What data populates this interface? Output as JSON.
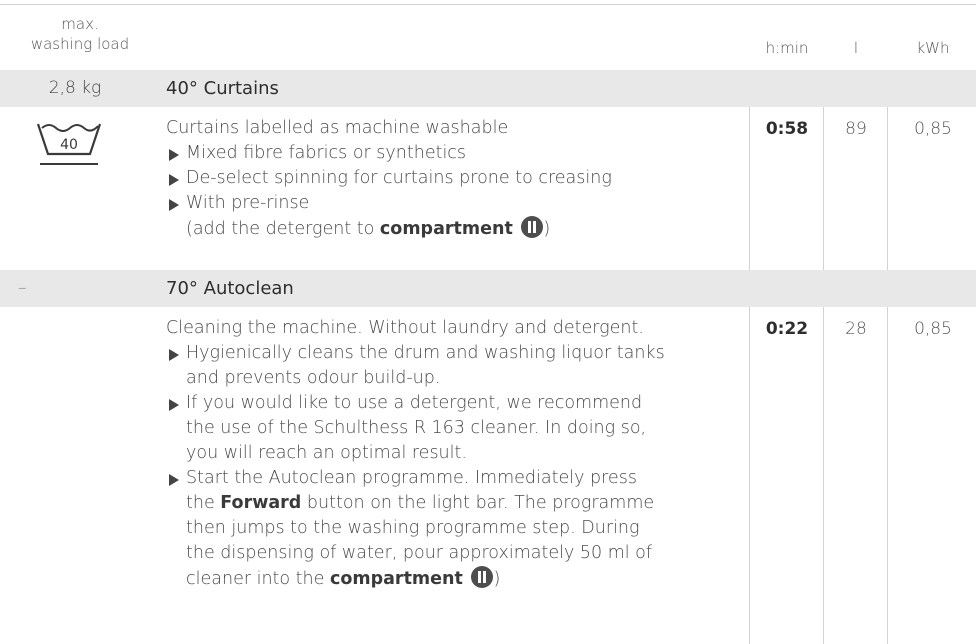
{
  "header": {
    "load_line1": "max.",
    "load_line2": "washing load",
    "time_col": "h:min",
    "litres_col": "l",
    "energy_col": "kWh"
  },
  "programmes": [
    {
      "load": "2,8 kg",
      "title": "40° Curtains",
      "care_symbol": {
        "icon": "wash-tub-40-icon",
        "temp": "40"
      },
      "intro": "Curtains labelled as machine washable",
      "bullet1": "Mixed fibre fabrics or synthetics",
      "bullet2": "De-select spinning for curtains prone to creasing",
      "bullet3": "With pre-rinse",
      "bullet3_cont_prefix": "(add the detergent to ",
      "bullet3_cont_bold": "compartment",
      "bullet3_cont_suffix": ")",
      "compartment_icon": "compartment-II-icon",
      "time": "0:58",
      "litres": "89",
      "energy": "0,85"
    },
    {
      "load": "–",
      "title": "70° Autoclean",
      "intro": "Cleaning the machine. Without laundry and detergent.",
      "b1_l1": "Hygienically cleans the drum and washing liquor tanks",
      "b1_l2": "and prevents odour build-up.",
      "b2_l1": "If you would like to use a detergent, we recommend",
      "b2_l2": "the use of the Schulthess R 163 cleaner. In doing so,",
      "b2_l3": "you will reach an optimal result.",
      "b3_l1": "Start the Autoclean programme. Immediately press",
      "b3_l2_pre": "the ",
      "b3_l2_bold": "Forward",
      "b3_l2_post": " button on the light bar. The programme",
      "b3_l3": "then jumps to the washing programme step. During",
      "b3_l4": "the dispensing of water, pour approximately 50 ml of",
      "b3_l5_pre": "cleaner into the ",
      "b3_l5_bold": "compartment",
      "b3_l5_post": ")",
      "compartment_icon": "compartment-II-icon",
      "time": "0:22",
      "litres": "28",
      "energy": "0,85"
    }
  ],
  "colors": {
    "band": "#e8e8e8",
    "rule": "#d4d4d4",
    "text": "#4a4a4a",
    "badge": "#4d4d4d"
  }
}
